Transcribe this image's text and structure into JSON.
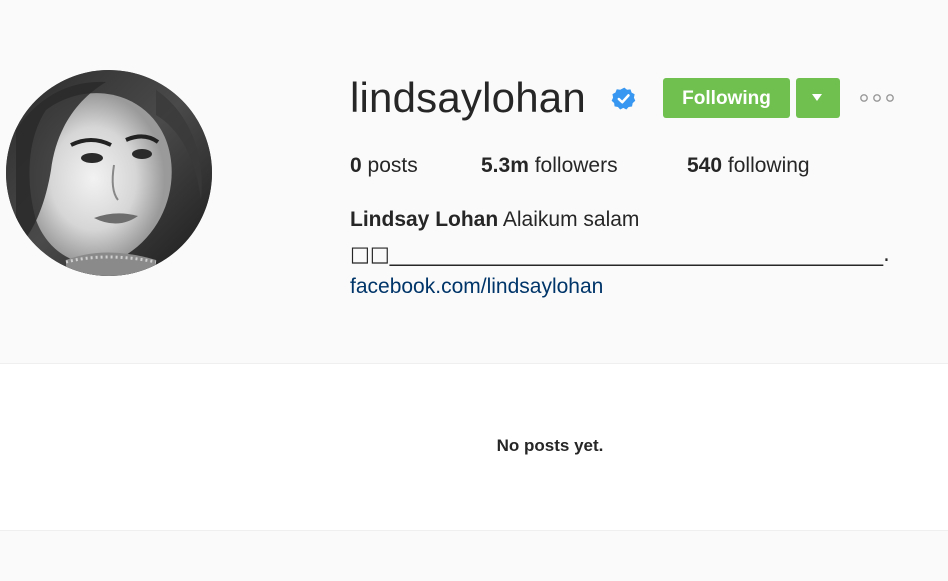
{
  "profile": {
    "username": "lindsaylohan",
    "verified": true,
    "follow_button_label": "Following",
    "stats": {
      "posts_count": "0",
      "posts_label": "posts",
      "followers_count": "5.3m",
      "followers_label": "followers",
      "following_count": "540",
      "following_label": "following"
    },
    "bio": {
      "full_name": "Lindsay Lohan",
      "text": "Alaikum salam",
      "line2": "□□_______________________________________________.",
      "link": "facebook.com/lindsaylohan"
    }
  },
  "posts": {
    "empty_message": "No posts yet."
  },
  "colors": {
    "follow_green": "#70c050",
    "verified_blue": "#3897f0",
    "link_blue": "#003569"
  },
  "icons": {
    "verified": "verified-badge-icon",
    "dropdown": "caret-down-icon",
    "more": "more-options-icon"
  }
}
